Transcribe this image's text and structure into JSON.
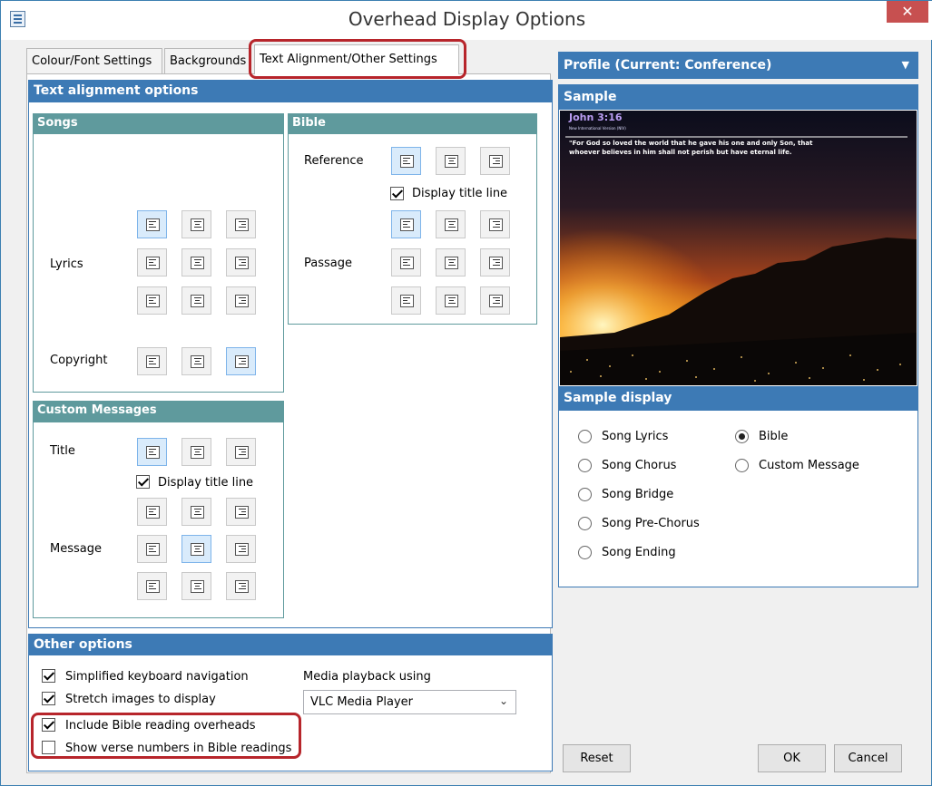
{
  "window": {
    "title": "Overhead Display Options",
    "close_glyph": "✕"
  },
  "tabs": [
    {
      "label": "Colour/Font Settings"
    },
    {
      "label": "Backgrounds"
    },
    {
      "label": "Text Alignment/Other Settings",
      "active": true
    }
  ],
  "text_alignment": {
    "header": "Text alignment options",
    "songs": {
      "header": "Songs",
      "lyrics_label": "Lyrics",
      "copyright_label": "Copyright"
    },
    "bible": {
      "header": "Bible",
      "reference_label": "Reference",
      "display_title_line": "Display title line",
      "display_title_line_checked": true,
      "passage_label": "Passage"
    },
    "custom_messages": {
      "header": "Custom Messages",
      "title_label": "Title",
      "display_title_line": "Display title line",
      "display_title_line_checked": true,
      "message_label": "Message"
    }
  },
  "other_options": {
    "header": "Other options",
    "checkboxes": [
      {
        "label": "Simplified keyboard navigation",
        "checked": true
      },
      {
        "label": "Stretch images to display",
        "checked": true
      },
      {
        "label": "Include Bible reading overheads",
        "checked": true
      },
      {
        "label": "Show verse numbers in Bible readings",
        "checked": false
      }
    ],
    "media_label": "Media playback using",
    "media_value": "VLC Media Player"
  },
  "profile": {
    "label": "Profile (Current: Conference)"
  },
  "sample": {
    "header": "Sample",
    "reference": "John 3:16",
    "version": "New International Version (NIV)",
    "verse_line1": "\"For God so loved the world that he gave his one and only Son, that",
    "verse_line2": "whoever believes in him shall not perish but have eternal life."
  },
  "sample_display": {
    "header": "Sample display",
    "col1": [
      {
        "label": "Song Lyrics",
        "selected": false
      },
      {
        "label": "Song Chorus",
        "selected": false
      },
      {
        "label": "Song Bridge",
        "selected": false
      },
      {
        "label": "Song Pre-Chorus",
        "selected": false
      },
      {
        "label": "Song Ending",
        "selected": false
      }
    ],
    "col2": [
      {
        "label": "Bible",
        "selected": true
      },
      {
        "label": "Custom Message",
        "selected": false
      }
    ]
  },
  "buttons": {
    "reset": "Reset",
    "ok": "OK",
    "cancel": "Cancel"
  },
  "colors": {
    "section_header": "#3d7ab5",
    "subsection_header": "#5f9a9d",
    "highlight_border": "#b7252b",
    "selected_button": "#d9ebfb"
  }
}
